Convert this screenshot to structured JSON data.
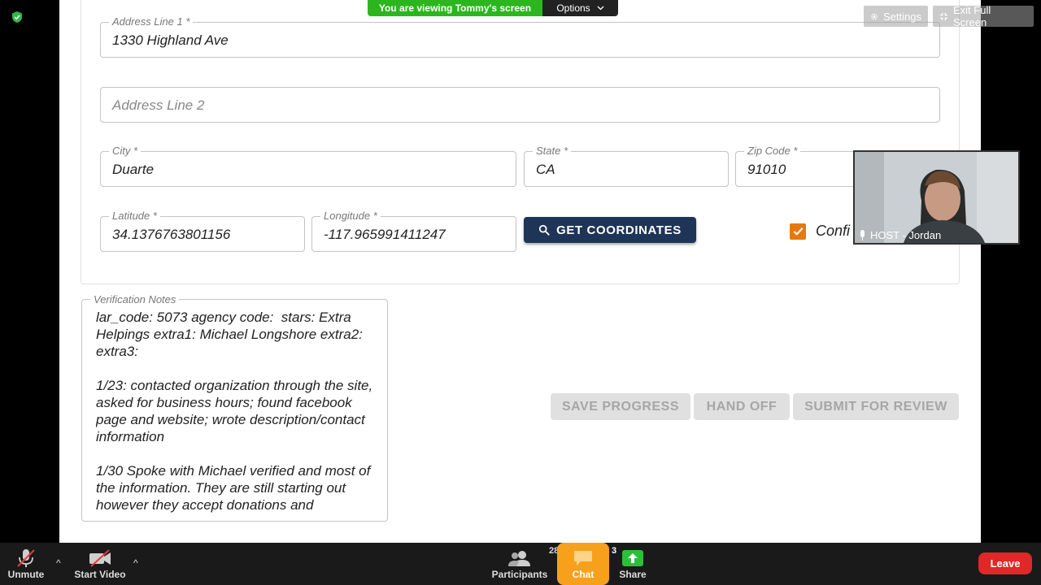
{
  "form": {
    "address1": {
      "label": "Address Line 1 *",
      "value": "1330 Highland Ave"
    },
    "address2": {
      "placeholder": "Address Line 2"
    },
    "city": {
      "label": "City *",
      "value": "Duarte"
    },
    "state": {
      "label": "State *",
      "value": "CA"
    },
    "zip": {
      "label": "Zip Code *",
      "value": "91010"
    },
    "latitude": {
      "label": "Latitude *",
      "value": "34.1376763801156"
    },
    "longitude": {
      "label": "Longitude *",
      "value": "-117.965991411247"
    },
    "get_coordinates_label": "GET COORDINATES",
    "confirm_label": "Confi",
    "confirm_checked": true,
    "notes": {
      "label": "Verification Notes",
      "text": "lar_code: 5073 agency code:  stars: Extra Helpings extra1: Michael Longshore extra2:  extra3:\n\n1/23: contacted organization through the site, asked for business hours; found facebook page and website; wrote description/contact information\n\n1/30 Spoke with Michael verified and most of the information. They are still starting out however they accept donations and"
    },
    "actions": {
      "save": "SAVE PROGRESS",
      "handoff": "HAND OFF",
      "submit": "SUBMIT FOR REVIEW"
    }
  },
  "zoom": {
    "viewing_banner": "You are viewing Tommy's screen",
    "options_label": "Options",
    "settings_label": "Settings",
    "exit_fullscreen_label": "Exit Full Screen",
    "video_name": "HOST - Jordan",
    "toolbar": {
      "unmute": "Unmute",
      "start_video": "Start Video",
      "participants": "Participants",
      "participants_count": "28",
      "chat": "Chat",
      "chat_count": "3",
      "share": "Share",
      "leave": "Leave"
    },
    "colors": {
      "banner_green": "#2db51f",
      "leave_red": "#e02828",
      "chat_orange": "#f7a01b",
      "button_navy": "#1f3557",
      "checkbox_orange": "#e8770c"
    }
  }
}
